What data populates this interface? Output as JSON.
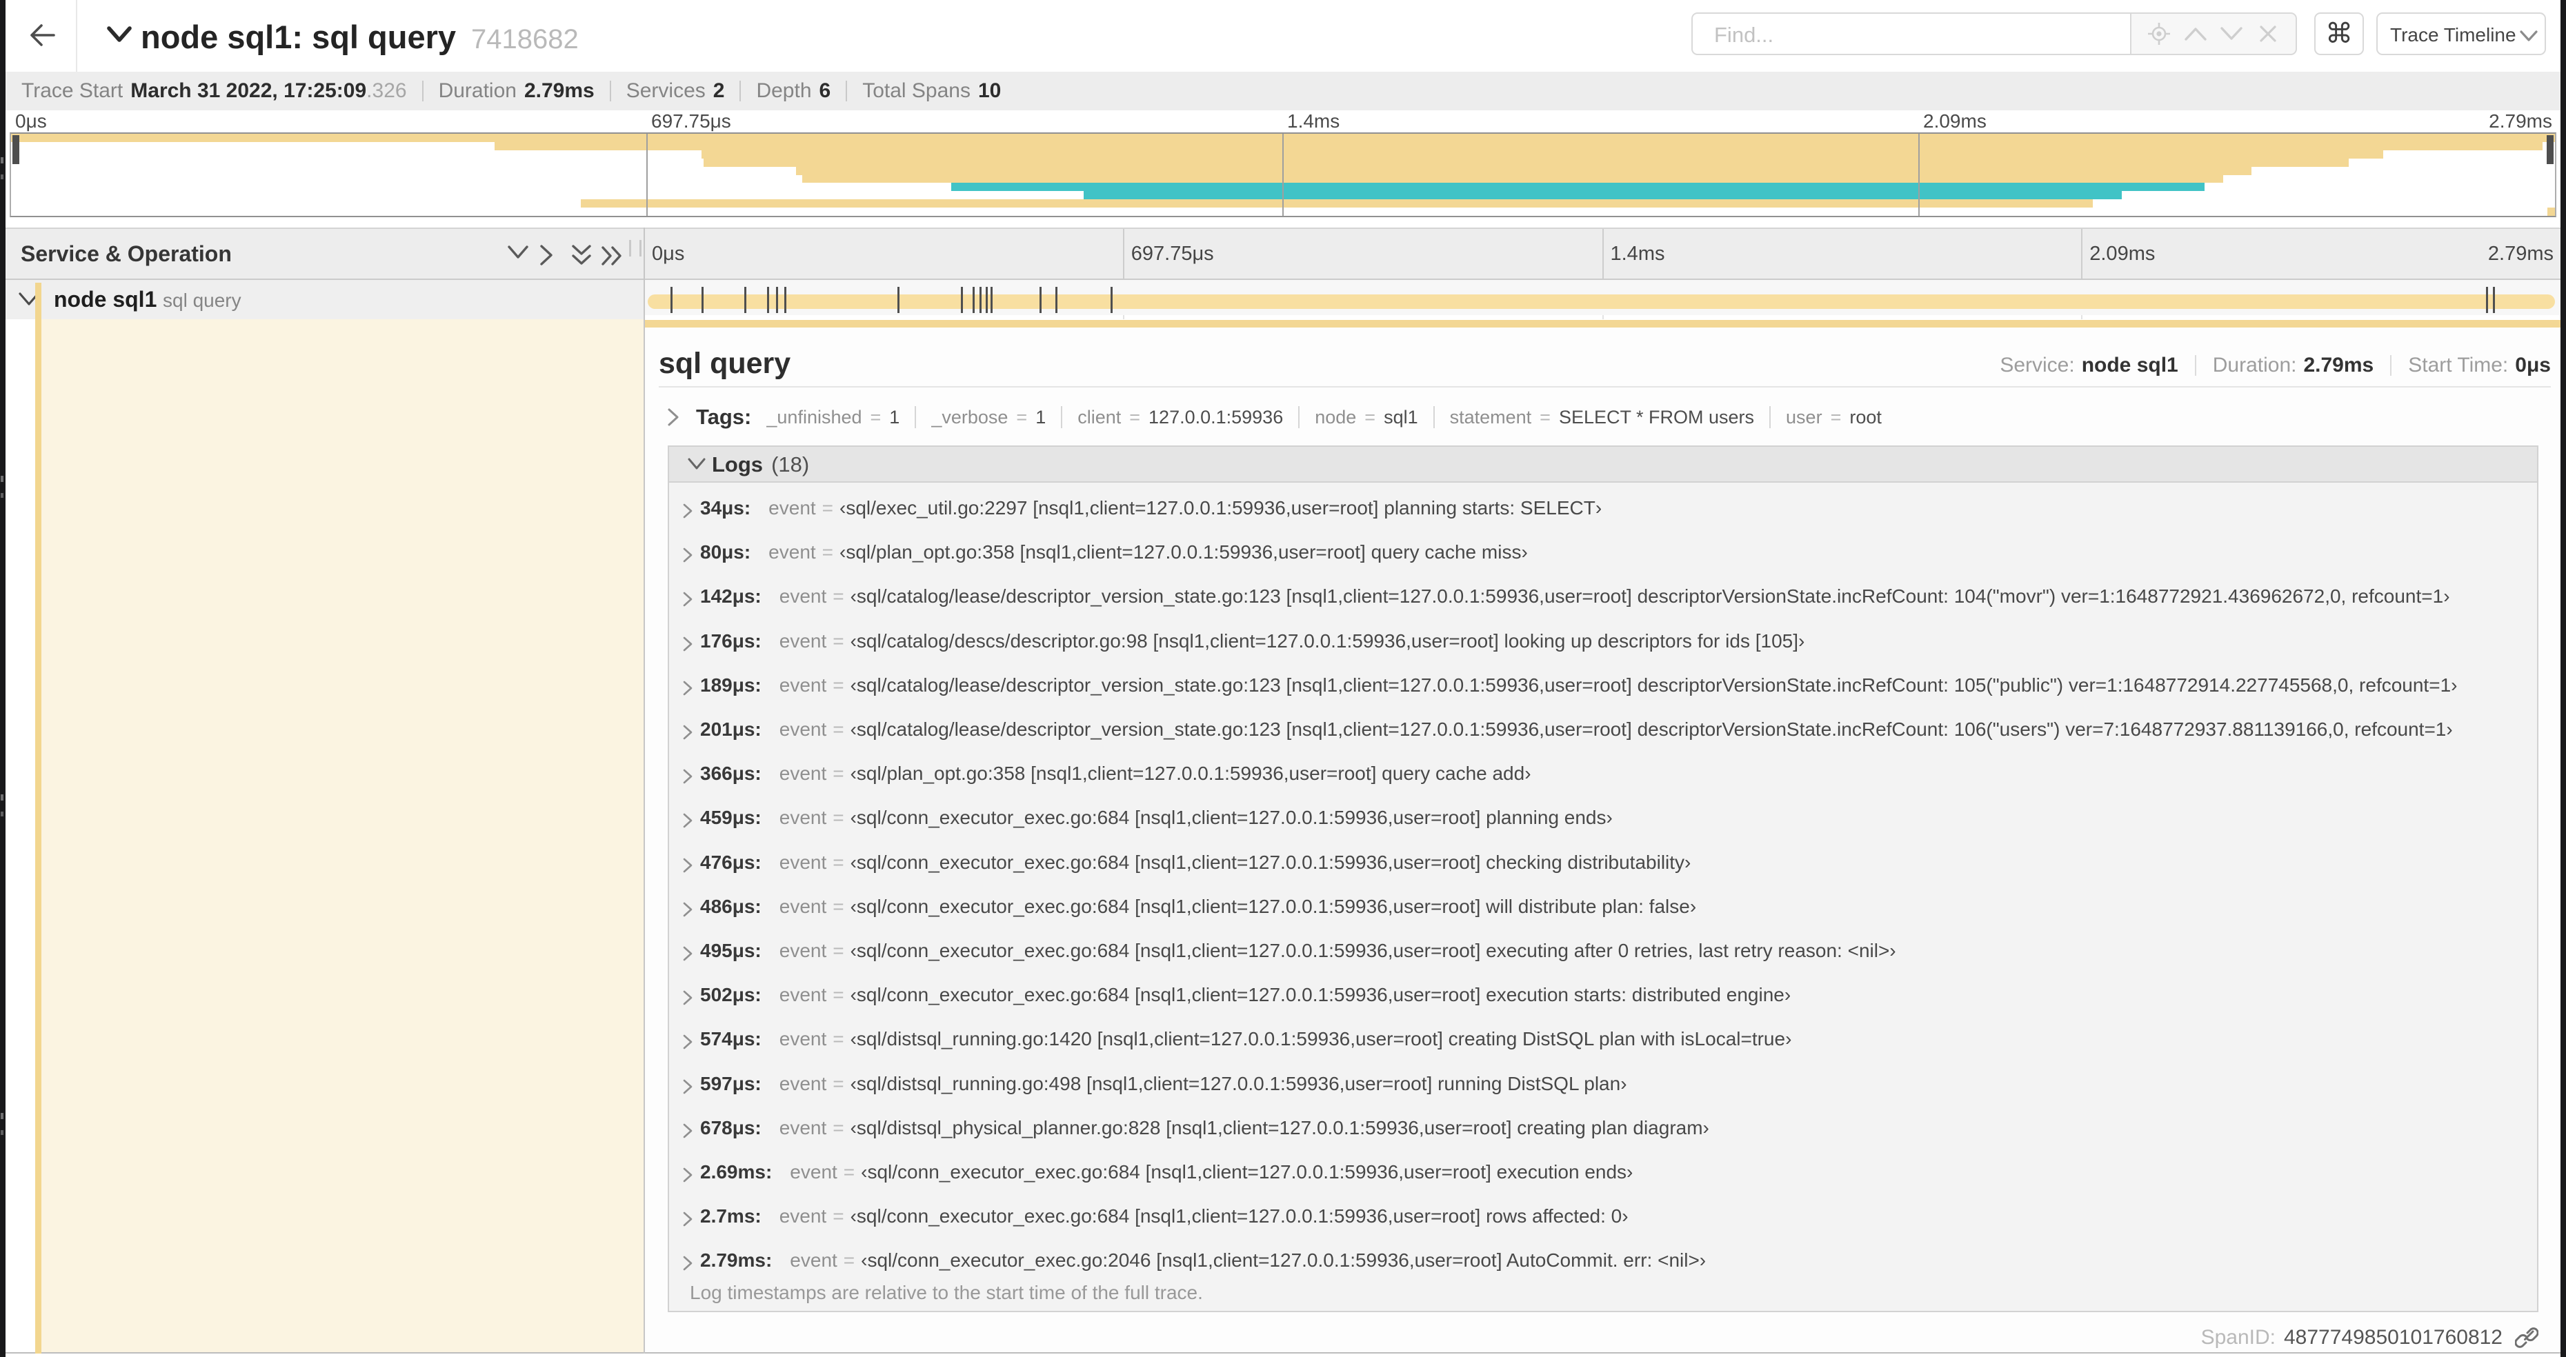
{
  "colors": {
    "span_tan": "#f8dfa1",
    "span_tan_strong": "#f3d794",
    "span_teal": "#41c3c6",
    "detail_cream": "#fbf4e1",
    "header_gray": "#ededed"
  },
  "topbar": {
    "title": "node sql1: sql query",
    "trace_id": "7418682",
    "find": {
      "placeholder": "Find..."
    },
    "shortcuts_button": "⌘",
    "view_select": {
      "value": "Trace Timeline"
    }
  },
  "trace_stats": {
    "items": [
      {
        "label": "Trace Start",
        "value": "March 31 2022, 17:25:09",
        "suffix": ".326"
      },
      {
        "label": "Duration",
        "value": "2.79ms"
      },
      {
        "label": "Services",
        "value": "2"
      },
      {
        "label": "Depth",
        "value": "6"
      },
      {
        "label": "Total Spans",
        "value": "10"
      }
    ]
  },
  "minimap": {
    "ticks": [
      "0μs",
      "697.75μs",
      "1.4ms",
      "2.09ms",
      "2.79ms"
    ],
    "spans": [
      {
        "start": 0.0,
        "end": 1.0,
        "color": "tan"
      },
      {
        "start": 0.19,
        "end": 0.995,
        "color": "tan"
      },
      {
        "start": 0.2715,
        "end": 0.9324,
        "color": "tan"
      },
      {
        "start": 0.2721,
        "end": 0.9188,
        "color": "tan"
      },
      {
        "start": 0.3087,
        "end": 0.8807,
        "color": "tan"
      },
      {
        "start": 0.3111,
        "end": 0.8696,
        "color": "tan"
      },
      {
        "start": 0.3696,
        "end": 0.8623,
        "color": "teal"
      },
      {
        "start": 0.4217,
        "end": 0.8297,
        "color": "teal"
      },
      {
        "start": 0.2239,
        "end": 0.8184,
        "color": "tan"
      },
      {
        "start": 0.997,
        "end": 1.0,
        "color": "tan"
      }
    ]
  },
  "timeline": {
    "name_column_header": "Service & Operation",
    "ticks": [
      "0μs",
      "697.75μs",
      "1.4ms",
      "2.09ms",
      "2.79ms"
    ],
    "row": {
      "service": "node sql1",
      "operation": "sql query",
      "duration_us": 2790,
      "marker_timestamps_us": [
        34,
        80,
        142,
        176,
        189,
        201,
        366,
        459,
        476,
        486,
        495,
        502,
        574,
        597,
        678,
        2690,
        2700
      ]
    }
  },
  "detail": {
    "operation": "sql query",
    "meta": [
      {
        "label": "Service:",
        "value": "node sql1"
      },
      {
        "label": "Duration:",
        "value": "2.79ms"
      },
      {
        "label": "Start Time:",
        "value": "0μs"
      }
    ],
    "tags": {
      "label": "Tags:",
      "equals_sign": "=",
      "items": [
        {
          "key": "_unfinished",
          "value": "1"
        },
        {
          "key": "_verbose",
          "value": "1"
        },
        {
          "key": "client",
          "value": "127.0.0.1:59936"
        },
        {
          "key": "node",
          "value": "sql1"
        },
        {
          "key": "statement",
          "value": "SELECT * FROM users"
        },
        {
          "key": "user",
          "value": "root"
        }
      ]
    },
    "logs": {
      "label": "Logs",
      "count": "(18)",
      "field": "event",
      "equals_sign": "=",
      "rows": [
        {
          "time": "34μs:",
          "value": "‹sql/exec_util.go:2297 [nsql1,client=127.0.0.1:59936,user=root] planning starts: SELECT›"
        },
        {
          "time": "80μs:",
          "value": "‹sql/plan_opt.go:358 [nsql1,client=127.0.0.1:59936,user=root] query cache miss›"
        },
        {
          "time": "142μs:",
          "value": "‹sql/catalog/lease/descriptor_version_state.go:123 [nsql1,client=127.0.0.1:59936,user=root] descriptorVersionState.incRefCount: 104(\"movr\") ver=1:1648772921.436962672,0, refcount=1›"
        },
        {
          "time": "176μs:",
          "value": "‹sql/catalog/descs/descriptor.go:98 [nsql1,client=127.0.0.1:59936,user=root] looking up descriptors for ids [105]›"
        },
        {
          "time": "189μs:",
          "value": "‹sql/catalog/lease/descriptor_version_state.go:123 [nsql1,client=127.0.0.1:59936,user=root] descriptorVersionState.incRefCount: 105(\"public\") ver=1:1648772914.227745568,0, refcount=1›"
        },
        {
          "time": "201μs:",
          "value": "‹sql/catalog/lease/descriptor_version_state.go:123 [nsql1,client=127.0.0.1:59936,user=root] descriptorVersionState.incRefCount: 106(\"users\") ver=7:1648772937.881139166,0, refcount=1›"
        },
        {
          "time": "366μs:",
          "value": "‹sql/plan_opt.go:358 [nsql1,client=127.0.0.1:59936,user=root] query cache add›"
        },
        {
          "time": "459μs:",
          "value": "‹sql/conn_executor_exec.go:684 [nsql1,client=127.0.0.1:59936,user=root] planning ends›"
        },
        {
          "time": "476μs:",
          "value": "‹sql/conn_executor_exec.go:684 [nsql1,client=127.0.0.1:59936,user=root] checking distributability›"
        },
        {
          "time": "486μs:",
          "value": "‹sql/conn_executor_exec.go:684 [nsql1,client=127.0.0.1:59936,user=root] will distribute plan: false›"
        },
        {
          "time": "495μs:",
          "value": "‹sql/conn_executor_exec.go:684 [nsql1,client=127.0.0.1:59936,user=root] executing after 0 retries, last retry reason: <nil>›"
        },
        {
          "time": "502μs:",
          "value": "‹sql/conn_executor_exec.go:684 [nsql1,client=127.0.0.1:59936,user=root] execution starts: distributed engine›"
        },
        {
          "time": "574μs:",
          "value": "‹sql/distsql_running.go:1420 [nsql1,client=127.0.0.1:59936,user=root] creating DistSQL plan with isLocal=true›"
        },
        {
          "time": "597μs:",
          "value": "‹sql/distsql_running.go:498 [nsql1,client=127.0.0.1:59936,user=root] running DistSQL plan›"
        },
        {
          "time": "678μs:",
          "value": "‹sql/distsql_physical_planner.go:828 [nsql1,client=127.0.0.1:59936,user=root] creating plan diagram›"
        },
        {
          "time": "2.69ms:",
          "value": "‹sql/conn_executor_exec.go:684 [nsql1,client=127.0.0.1:59936,user=root] execution ends›"
        },
        {
          "time": "2.7ms:",
          "value": "‹sql/conn_executor_exec.go:684 [nsql1,client=127.0.0.1:59936,user=root] rows affected: 0›"
        },
        {
          "time": "2.79ms:",
          "value": "‹sql/conn_executor_exec.go:2046 [nsql1,client=127.0.0.1:59936,user=root] AutoCommit. err: <nil>›"
        }
      ],
      "footer": "Log timestamps are relative to the start time of the full trace."
    },
    "span_id": {
      "label": "SpanID:",
      "value": "4877749850101760812"
    }
  }
}
